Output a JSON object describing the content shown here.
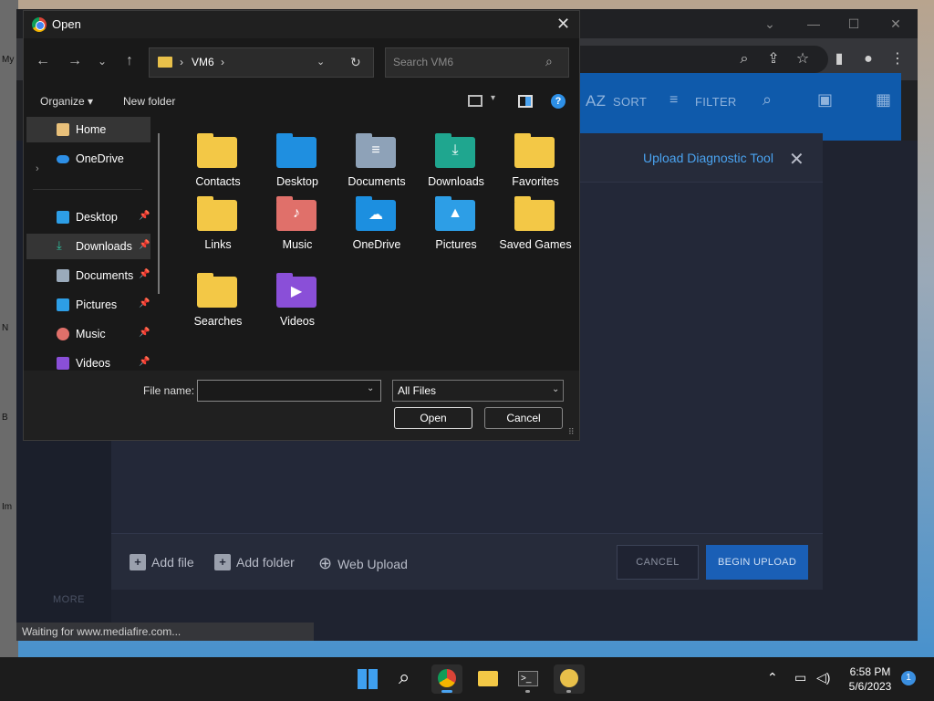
{
  "wallpaper": {
    "side_texts": [
      "My",
      "N",
      "B",
      "Im"
    ]
  },
  "browser": {
    "status_text": "Waiting for www.mediafire.com...",
    "window_controls": [
      "chevron-down-icon",
      "minimize-icon",
      "maximize-icon",
      "close-icon"
    ],
    "toolbar_icons": [
      "search-icon",
      "share-icon",
      "star-icon",
      "sidebar-icon",
      "profile-icon",
      "menu-icon"
    ]
  },
  "mediafire": {
    "toolbar": {
      "sort_label": "SORT",
      "filter_label": "FILTER"
    },
    "upload_panel": {
      "title": "Upload Diagnostic Tool",
      "add_file": "Add file",
      "add_folder": "Add folder",
      "web_upload": "Web Upload",
      "cancel": "CANCEL",
      "begin_upload": "BEGIN UPLOAD"
    },
    "more_label": "MORE"
  },
  "dialog": {
    "title": "Open",
    "address": {
      "path": "VM6"
    },
    "search": {
      "placeholder": "Search VM6"
    },
    "commands": {
      "organize": "Organize",
      "new_folder": "New folder"
    },
    "nav_items": [
      {
        "label": "Home",
        "icon": "home-icon",
        "selected": true,
        "pinned": false
      },
      {
        "label": "OneDrive",
        "icon": "cloud-icon",
        "selected": false,
        "pinned": false
      },
      {
        "label": "Desktop",
        "icon": "desktop-icon",
        "selected": false,
        "pinned": true
      },
      {
        "label": "Downloads",
        "icon": "download-icon",
        "selected": true,
        "pinned": true
      },
      {
        "label": "Documents",
        "icon": "document-icon",
        "selected": false,
        "pinned": true
      },
      {
        "label": "Pictures",
        "icon": "picture-icon",
        "selected": false,
        "pinned": true
      },
      {
        "label": "Music",
        "icon": "music-icon",
        "selected": false,
        "pinned": true
      },
      {
        "label": "Videos",
        "icon": "video-icon",
        "selected": false,
        "pinned": true
      }
    ],
    "files": [
      {
        "name": "Contacts",
        "icon": "folder-icon",
        "color": "#f3c846"
      },
      {
        "name": "Desktop",
        "icon": "desktop-folder-icon",
        "color": "#1f8fe0"
      },
      {
        "name": "Documents",
        "icon": "documents-folder-icon",
        "color": "#8ea2b8"
      },
      {
        "name": "Downloads",
        "icon": "downloads-folder-icon",
        "color": "#1fa68f"
      },
      {
        "name": "Favorites",
        "icon": "folder-icon",
        "color": "#f3c846"
      },
      {
        "name": "Links",
        "icon": "folder-icon",
        "color": "#f3c846"
      },
      {
        "name": "Music",
        "icon": "music-folder-icon",
        "color": "#e0706a"
      },
      {
        "name": "OneDrive",
        "icon": "onedrive-folder-icon",
        "color": "#1c8fe0"
      },
      {
        "name": "Pictures",
        "icon": "pictures-folder-icon",
        "color": "#2d9ee6"
      },
      {
        "name": "Saved Games",
        "icon": "folder-icon",
        "color": "#f3c846"
      },
      {
        "name": "Searches",
        "icon": "folder-icon",
        "color": "#f3c846"
      },
      {
        "name": "Videos",
        "icon": "videos-folder-icon",
        "color": "#8a4fd8"
      }
    ],
    "file_name_label": "File name:",
    "file_name_value": "",
    "file_type": "All Files",
    "open_button": "Open",
    "cancel_button": "Cancel"
  },
  "taskbar": {
    "apps": [
      "windows-start-icon",
      "search-icon",
      "chrome-icon",
      "file-explorer-icon",
      "terminal-icon",
      "bee-app-icon"
    ],
    "time": "6:58 PM",
    "date": "5/6/2023",
    "notification_count": "1"
  }
}
